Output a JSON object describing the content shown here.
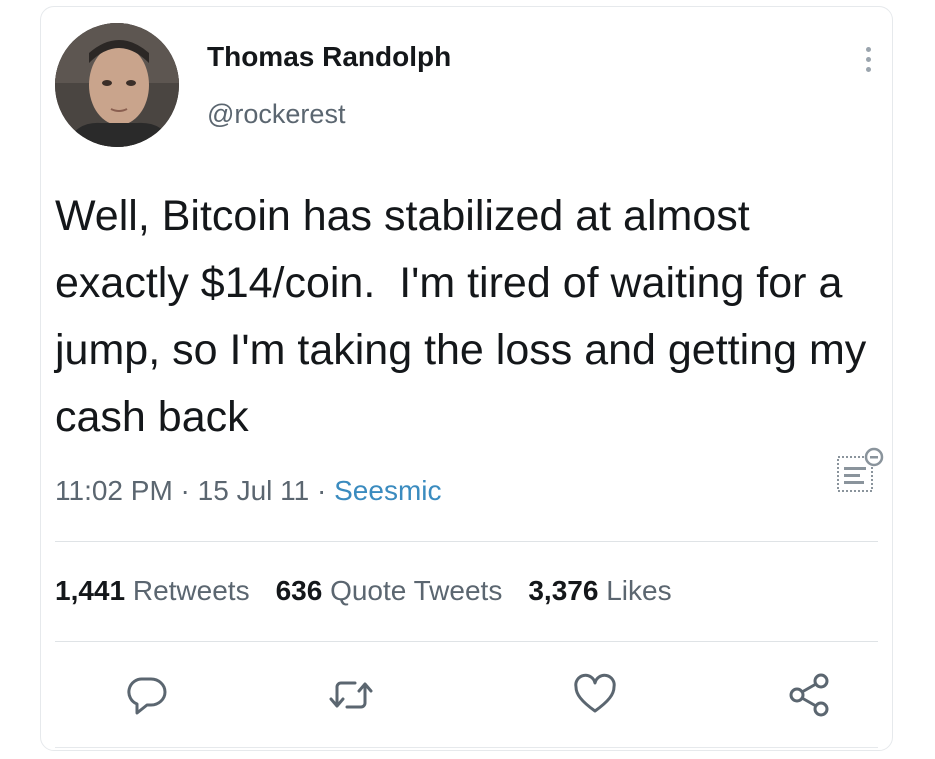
{
  "tweet": {
    "author": {
      "display_name": "Thomas Randolph",
      "handle": "@rockerest"
    },
    "text": "Well, Bitcoin has stabilized at almost exactly $14/coin.  I'm tired of waiting for a jump, so I'm taking the loss and getting my cash back",
    "meta": {
      "time": "11:02 PM",
      "separator1": " · ",
      "date": "15 Jul 11",
      "separator2": " · ",
      "source": "Seesmic"
    },
    "stats": {
      "retweets_count": "1,441",
      "retweets_label": "Retweets",
      "quotes_count": "636",
      "quotes_label": "Quote Tweets",
      "likes_count": "3,376",
      "likes_label": "Likes"
    },
    "icons": {
      "more": "more-vertical-icon",
      "translate": "translate-icon",
      "reply": "reply-icon",
      "retweet": "retweet-icon",
      "like": "heart-icon",
      "share": "share-icon"
    }
  },
  "colors": {
    "text_primary": "#14171a",
    "text_secondary": "#5b6670",
    "link": "#3a8bbf",
    "divider": "#dfe3e6"
  }
}
